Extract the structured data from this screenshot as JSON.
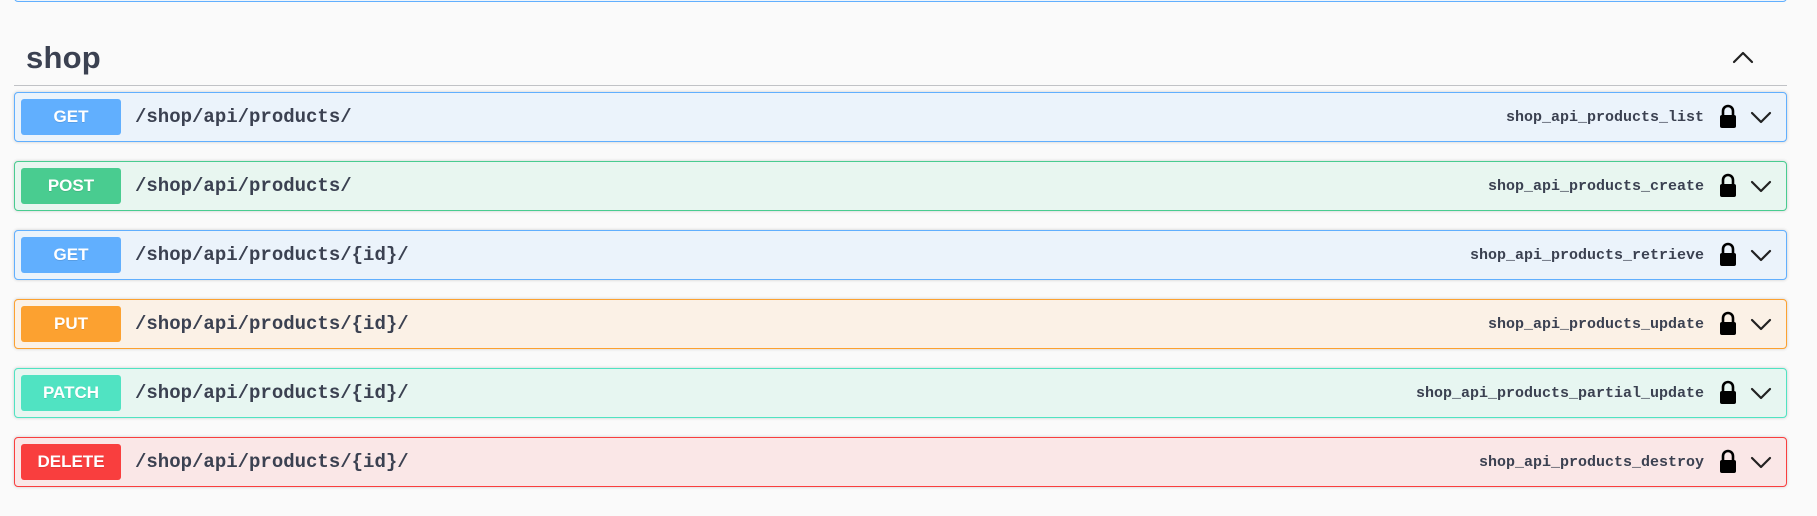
{
  "tag": {
    "title": "shop"
  },
  "operations": [
    {
      "method": "GET",
      "path": "/shop/api/products/",
      "operation_id": "shop_api_products_list",
      "color": "#61affe",
      "bg": "#ebf3fb"
    },
    {
      "method": "POST",
      "path": "/shop/api/products/",
      "operation_id": "shop_api_products_create",
      "color": "#49cc90",
      "bg": "#e8f6f0"
    },
    {
      "method": "GET",
      "path": "/shop/api/products/{id}/",
      "operation_id": "shop_api_products_retrieve",
      "color": "#61affe",
      "bg": "#ebf3fb"
    },
    {
      "method": "PUT",
      "path": "/shop/api/products/{id}/",
      "operation_id": "shop_api_products_update",
      "color": "#fca130",
      "bg": "#fbf1e6"
    },
    {
      "method": "PATCH",
      "path": "/shop/api/products/{id}/",
      "operation_id": "shop_api_products_partial_update",
      "color": "#50e3c2",
      "bg": "#e7f6f1"
    },
    {
      "method": "DELETE",
      "path": "/shop/api/products/{id}/",
      "operation_id": "shop_api_products_destroy",
      "color": "#f93e3e",
      "bg": "#fae7e7"
    }
  ],
  "icons": {
    "collapse": "chevron-up-icon",
    "lock": "lock-icon",
    "expand": "chevron-down-icon"
  }
}
